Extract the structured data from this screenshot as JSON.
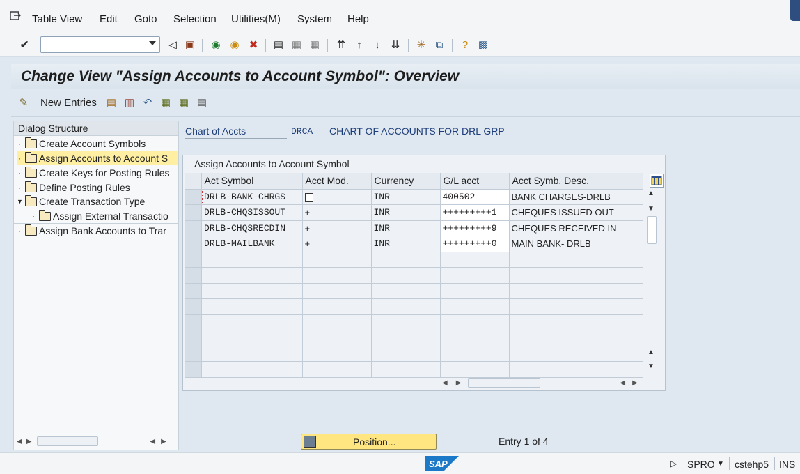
{
  "menu": {
    "items": [
      "Table View",
      "Edit",
      "Goto",
      "Selection",
      "Utilities(M)",
      "System",
      "Help"
    ]
  },
  "toolbar": {
    "command_value": ""
  },
  "title": "Change View \"Assign Accounts to Account Symbol\": Overview",
  "app_toolbar": {
    "new_entries": "New Entries"
  },
  "dialog_structure": {
    "heading": "Dialog Structure",
    "items": [
      {
        "label": "Create Account Symbols",
        "level": 0
      },
      {
        "label": "Assign Accounts to Account S",
        "level": 0,
        "selected": true
      },
      {
        "label": "Create Keys for Posting Rules",
        "level": 0
      },
      {
        "label": "Define Posting Rules",
        "level": 0
      },
      {
        "label": "Create Transaction Type",
        "level": 0,
        "expanded": true
      },
      {
        "label": "Assign External Transactio",
        "level": 1
      },
      {
        "label": "Assign Bank Accounts to Trar",
        "level": 0
      }
    ]
  },
  "chart_of_accts": {
    "label": "Chart of Accts",
    "code": "DRCA",
    "description": "CHART OF ACCOUNTS FOR DRL GRP"
  },
  "table": {
    "caption": "Assign Accounts to Account Symbol",
    "columns": [
      "Act Symbol",
      "Acct Mod.",
      "Currency",
      "G/L acct",
      "Acct Symb. Desc."
    ],
    "rows": [
      [
        "DRLB-BANK-CHRGS",
        "",
        "INR",
        "400502",
        "BANK CHARGES-DRLB"
      ],
      [
        "DRLB-CHQSISSOUT",
        "+",
        "INR",
        "+++++++++1",
        "CHEQUES ISSUED OUT"
      ],
      [
        "DRLB-CHQSRECDIN",
        "+",
        "INR",
        "+++++++++9",
        "CHEQUES RECEIVED IN"
      ],
      [
        "DRLB-MAILBANK",
        "+",
        "INR",
        "+++++++++0",
        "MAIN BANK- DRLB"
      ]
    ],
    "empty_rows": 8
  },
  "position_button": "Position...",
  "entry_info": "Entry 1 of 4",
  "status": {
    "system": "SPRO",
    "server": "cstehp5",
    "mode": "INS"
  },
  "colors": {
    "accent_blue": "#1e3e7a",
    "selection_yellow": "#ffefa3",
    "button_yellow": "#ffe680"
  }
}
